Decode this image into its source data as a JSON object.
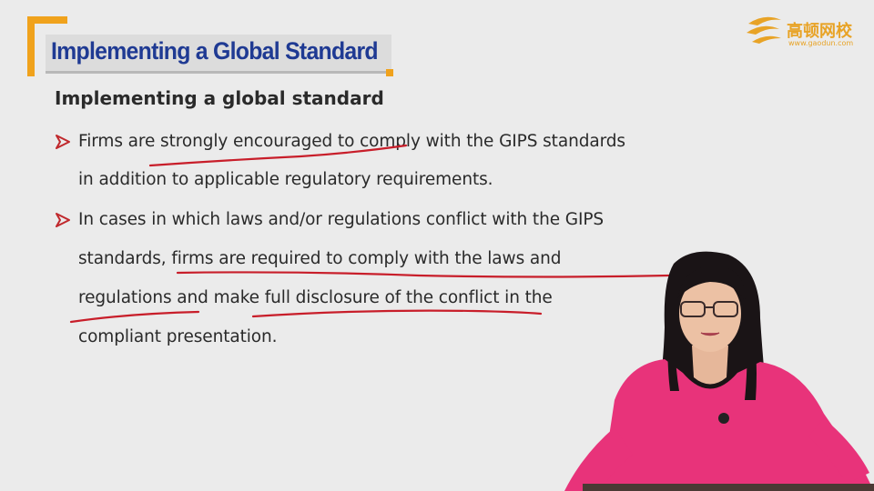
{
  "slide": {
    "title": "Implementing a Global Standard",
    "subheading": "Implementing a global standard",
    "bullets": [
      {
        "lines": [
          "Firms are strongly encouraged to comply with the GIPS standards",
          "in addition to applicable regulatory requirements."
        ]
      },
      {
        "lines": [
          "In cases in which laws and/or regulations conflict with the GIPS",
          "standards, firms are required to comply with the laws and",
          "regulations and make full disclosure of the conflict in the",
          "compliant presentation."
        ]
      }
    ]
  },
  "logo": {
    "name_cn": "高顿网校",
    "url": "www.gaodun.com"
  },
  "colors": {
    "accent_orange": "#f0a21c",
    "title_blue": "#1f3a93",
    "bullet_red": "#c0282c",
    "annotation_red": "#c81e2a",
    "presenter_shirt": "#e8337a"
  }
}
